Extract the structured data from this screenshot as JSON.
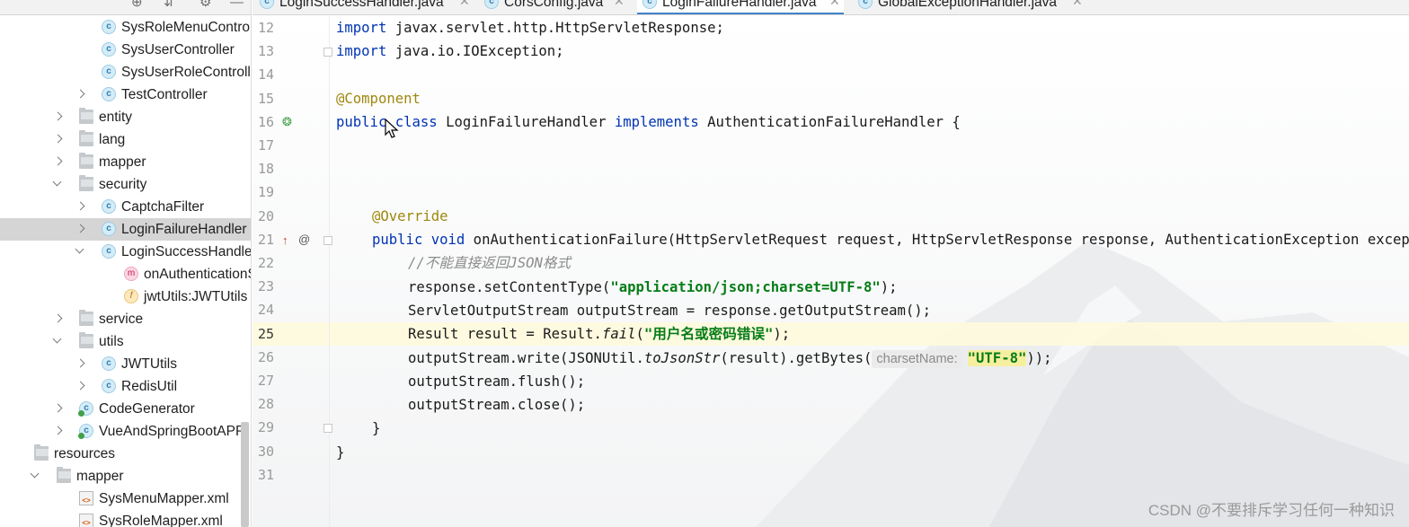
{
  "project_tree": [
    {
      "label": "SysRoleMenuController",
      "icon": "class-icon",
      "indent": 3,
      "arrow": "none"
    },
    {
      "label": "SysUserController",
      "icon": "class-icon",
      "indent": 3,
      "arrow": "none"
    },
    {
      "label": "SysUserRoleController",
      "icon": "class-icon",
      "indent": 3,
      "arrow": "none"
    },
    {
      "label": "TestController",
      "icon": "class-icon",
      "indent": 3,
      "arrow": "collapsed"
    },
    {
      "label": "entity",
      "icon": "folder-icon",
      "indent": 2,
      "arrow": "collapsed"
    },
    {
      "label": "lang",
      "icon": "folder-icon",
      "indent": 2,
      "arrow": "collapsed"
    },
    {
      "label": "mapper",
      "icon": "folder-icon",
      "indent": 2,
      "arrow": "collapsed"
    },
    {
      "label": "security",
      "icon": "folder-icon",
      "indent": 2,
      "arrow": "expanded"
    },
    {
      "label": "CaptchaFilter",
      "icon": "class-icon",
      "indent": 3,
      "arrow": "collapsed"
    },
    {
      "label": "LoginFailureHandler",
      "icon": "class-icon",
      "indent": 3,
      "arrow": "collapsed",
      "selected": true
    },
    {
      "label": "LoginSuccessHandler",
      "icon": "class-icon",
      "indent": 3,
      "arrow": "expanded"
    },
    {
      "label": "onAuthenticationSuccess",
      "icon": "method-icon",
      "indent": 4,
      "arrow": "none"
    },
    {
      "label": "jwtUtils:JWTUtils",
      "icon": "field-icon",
      "indent": 4,
      "arrow": "none"
    },
    {
      "label": "service",
      "icon": "folder-icon",
      "indent": 2,
      "arrow": "collapsed"
    },
    {
      "label": "utils",
      "icon": "folder-icon",
      "indent": 2,
      "arrow": "expanded"
    },
    {
      "label": "JWTUtils",
      "icon": "class-icon",
      "indent": 3,
      "arrow": "collapsed"
    },
    {
      "label": "RedisUtil",
      "icon": "class-icon",
      "indent": 3,
      "arrow": "collapsed"
    },
    {
      "label": "CodeGenerator",
      "icon": "runnable-class-icon",
      "indent": 2,
      "arrow": "collapsed"
    },
    {
      "label": "VueAndSpringBootAPP",
      "icon": "runnable-class-icon",
      "indent": 2,
      "arrow": "collapsed"
    },
    {
      "label": "resources",
      "icon": "resources-folder-icon",
      "indent": 0,
      "arrow": "none"
    },
    {
      "label": "mapper",
      "icon": "folder-icon",
      "indent": 1,
      "arrow": "expanded"
    },
    {
      "label": "SysMenuMapper.xml",
      "icon": "xml-file-icon",
      "indent": 2,
      "arrow": "none"
    },
    {
      "label": "SysRoleMapper.xml",
      "icon": "xml-file-icon",
      "indent": 2,
      "arrow": "none"
    }
  ],
  "tabs": [
    {
      "label": "LoginSuccessHandler.java",
      "active": false
    },
    {
      "label": "CorsConfig.java",
      "active": false
    },
    {
      "label": "LoginFailureHandler.java",
      "active": true
    },
    {
      "label": "GlobalExceptionHandler.java",
      "active": false
    }
  ],
  "editor": {
    "line_numbers": [
      "12",
      "13",
      "14",
      "15",
      "16",
      "17",
      "18",
      "19",
      "20",
      "21",
      "22",
      "23",
      "24",
      "25",
      "26",
      "27",
      "28",
      "29",
      "30",
      "31"
    ],
    "current_line": "25",
    "inlay_hint": "charsetName:",
    "code": {
      "l12_kw": "import",
      "l12_rest": " javax.servlet.http.HttpServletResponse;",
      "l13_kw": "import",
      "l13_rest": " java.io.IOException;",
      "l15_ann": "@Component",
      "l16_kw1": "public",
      "l16_kw2": " class",
      "l16_name": " LoginFailureHandler ",
      "l16_kw3": "implements",
      "l16_rest": " AuthenticationFailureHandler {",
      "l20_ann": "@Override",
      "l21_kw1": "public",
      "l21_kw2": " void",
      "l21_rest": " onAuthenticationFailure(HttpServletRequest request, HttpServletResponse response, AuthenticationException exception) throws IOException, ServletException {",
      "l22_cmt": "//不能直接返回JSON格式",
      "l23_pre": "response.setContentType(",
      "l23_str": "\"application/json;charset=UTF-8\"",
      "l23_post": ");",
      "l24": "ServletOutputStream outputStream = response.getOutputStream();",
      "l25_pre": "Result result = Result.",
      "l25_it": "fail",
      "l25_paren": "(",
      "l25_str": "\"用户名或密码错误\"",
      "l25_post": ");",
      "l26_pre": "outputStream.write(JSONUtil.",
      "l26_it": "toJsonStr",
      "l26_mid": "(result).getBytes(",
      "l26_str": "\"UTF-8\"",
      "l26_post": "));",
      "l27": "outputStream.flush();",
      "l28": "outputStream.close();",
      "l29": "}",
      "l30": "}"
    }
  },
  "watermark": "CSDN @不要排斥学习任何一种知识",
  "colors": {
    "keyword": "#0033b3",
    "annotation": "#9e880d",
    "string": "#067d17",
    "comment": "#8c8c8c",
    "selection": "#d5d5d5",
    "caret_row": "#fefadc",
    "active_tab_underline": "#4083c9"
  }
}
